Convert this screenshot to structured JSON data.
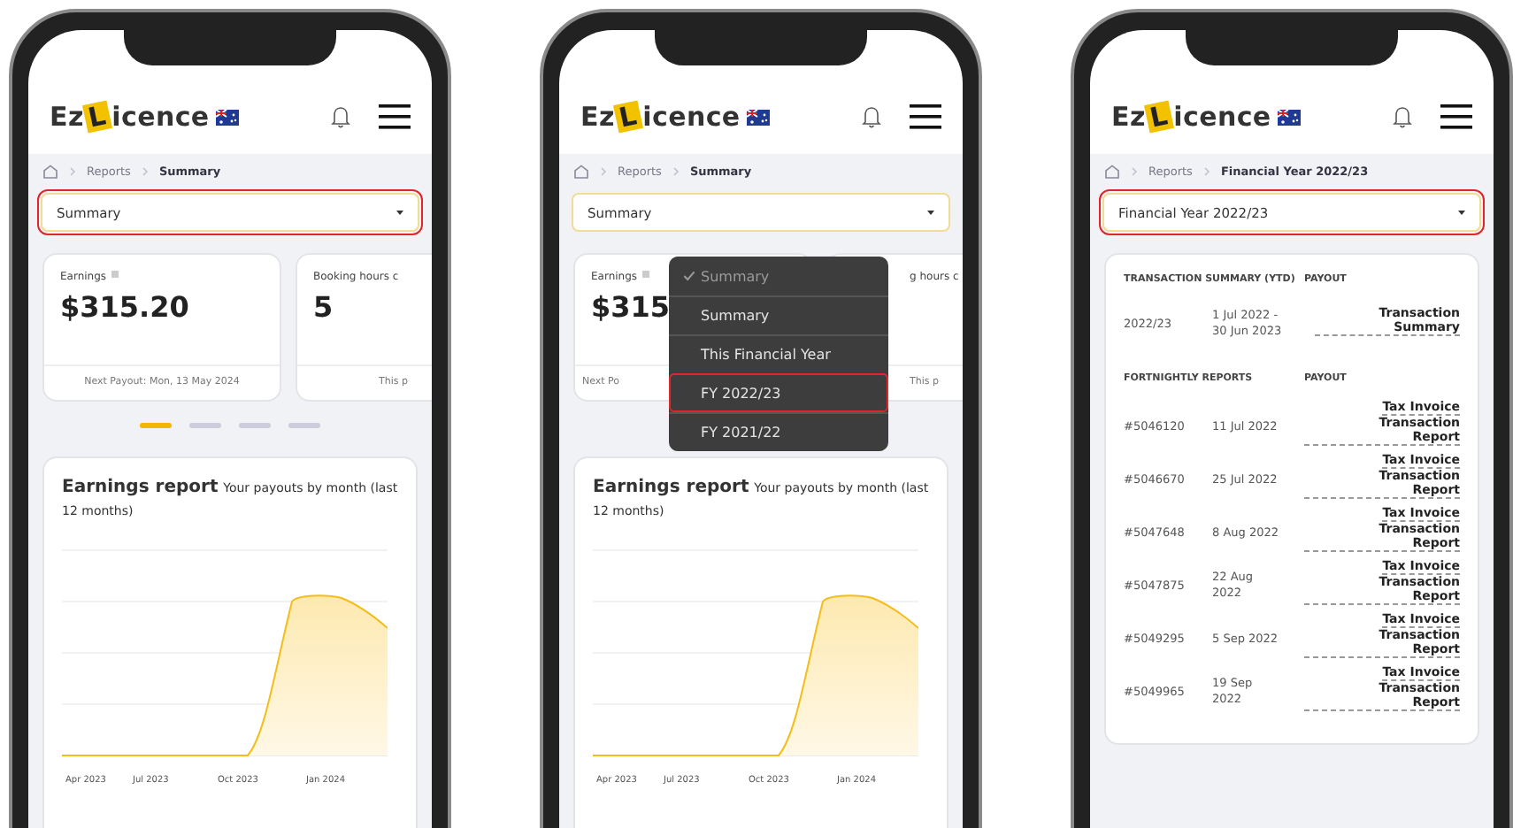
{
  "phones": [
    {
      "kind": "summary",
      "logo": {
        "prefix": "Ez",
        "mark": "L",
        "suffix": "icence"
      },
      "breadcrumb": [
        "Reports",
        "Summary"
      ],
      "select": {
        "value": "Summary",
        "highlighted": true
      },
      "cards": [
        {
          "label": "Earnings",
          "info": true,
          "value": "$315.20",
          "footer": "Next Payout: Mon, 13 May 2024"
        },
        {
          "label": "Booking hours c",
          "value": "5",
          "footer": "This p"
        }
      ],
      "pager": [
        {
          "selected": true
        },
        {
          "selected": false
        },
        {
          "selected": false
        },
        {
          "selected": false
        }
      ],
      "report": {
        "title": "Earnings report",
        "subtitle": "Your payouts by month (last 12 months)",
        "axis_labels": [
          "Apr 2023",
          "Jul 2023",
          "Oct 2023",
          "Jan 2024"
        ]
      }
    },
    {
      "kind": "summary",
      "logo": {
        "prefix": "Ez",
        "mark": "L",
        "suffix": "icence"
      },
      "breadcrumb": [
        "Reports",
        "Summary"
      ],
      "select": {
        "value": "Summary",
        "highlighted": false
      },
      "cards": [
        {
          "label": "Earnings",
          "info": true,
          "value": "$315",
          "footer": "Next Po"
        },
        {
          "label": "g hours c",
          "footer": "This p"
        }
      ],
      "menu": [
        {
          "label": "Summary",
          "selected": true,
          "highlighted": false
        },
        {
          "label": "Summary",
          "selected": false,
          "highlighted": false
        },
        {
          "label": "This Financial Year",
          "selected": false,
          "highlighted": false
        },
        {
          "label": "FY 2022/23",
          "selected": false,
          "highlighted": true
        },
        {
          "label": "FY 2021/22",
          "selected": false,
          "highlighted": false
        }
      ],
      "report": {
        "title": "Earnings report",
        "subtitle": "Your payouts by month (last 12 months)",
        "axis_labels": [
          "Apr 2023",
          "Jul 2023",
          "Oct 2023",
          "Jan 2024"
        ]
      }
    },
    {
      "kind": "financial_year",
      "logo": {
        "prefix": "Ez",
        "mark": "L",
        "suffix": "icence"
      },
      "breadcrumb": [
        "Reports",
        "Financial Year 2022/23"
      ],
      "select": {
        "value": "Financial Year 2022/23",
        "highlighted": true
      },
      "tables": [
        {
          "headings": [
            "TRANSACTION SUMMARY (YTD)",
            "PAYOUT"
          ],
          "rows": [
            {
              "id": "2022/23",
              "date": "1 Jul 2022 - 30 Jun 2023",
              "links": [
                "Transaction Summary"
              ]
            }
          ]
        },
        {
          "headings": [
            "FORTNIGHTLY REPORTS",
            "PAYOUT"
          ],
          "rows": [
            {
              "id": "#5046120",
              "date": "11 Jul 2022",
              "links": [
                "Tax Invoice",
                "Transaction Report"
              ]
            },
            {
              "id": "#5046670",
              "date": "25 Jul 2022",
              "links": [
                "Tax Invoice",
                "Transaction Report"
              ]
            },
            {
              "id": "#5047648",
              "date": "8 Aug 2022",
              "links": [
                "Tax Invoice",
                "Transaction Report"
              ]
            },
            {
              "id": "#5047875",
              "date": "22 Aug 2022",
              "links": [
                "Tax Invoice",
                "Transaction Report"
              ]
            },
            {
              "id": "#5049295",
              "date": "5 Sep 2022",
              "links": [
                "Tax Invoice",
                "Transaction Report"
              ]
            },
            {
              "id": "#5049965",
              "date": "19 Sep 2022",
              "links": [
                "Tax Invoice",
                "Transaction Report"
              ]
            }
          ]
        }
      ]
    }
  ]
}
